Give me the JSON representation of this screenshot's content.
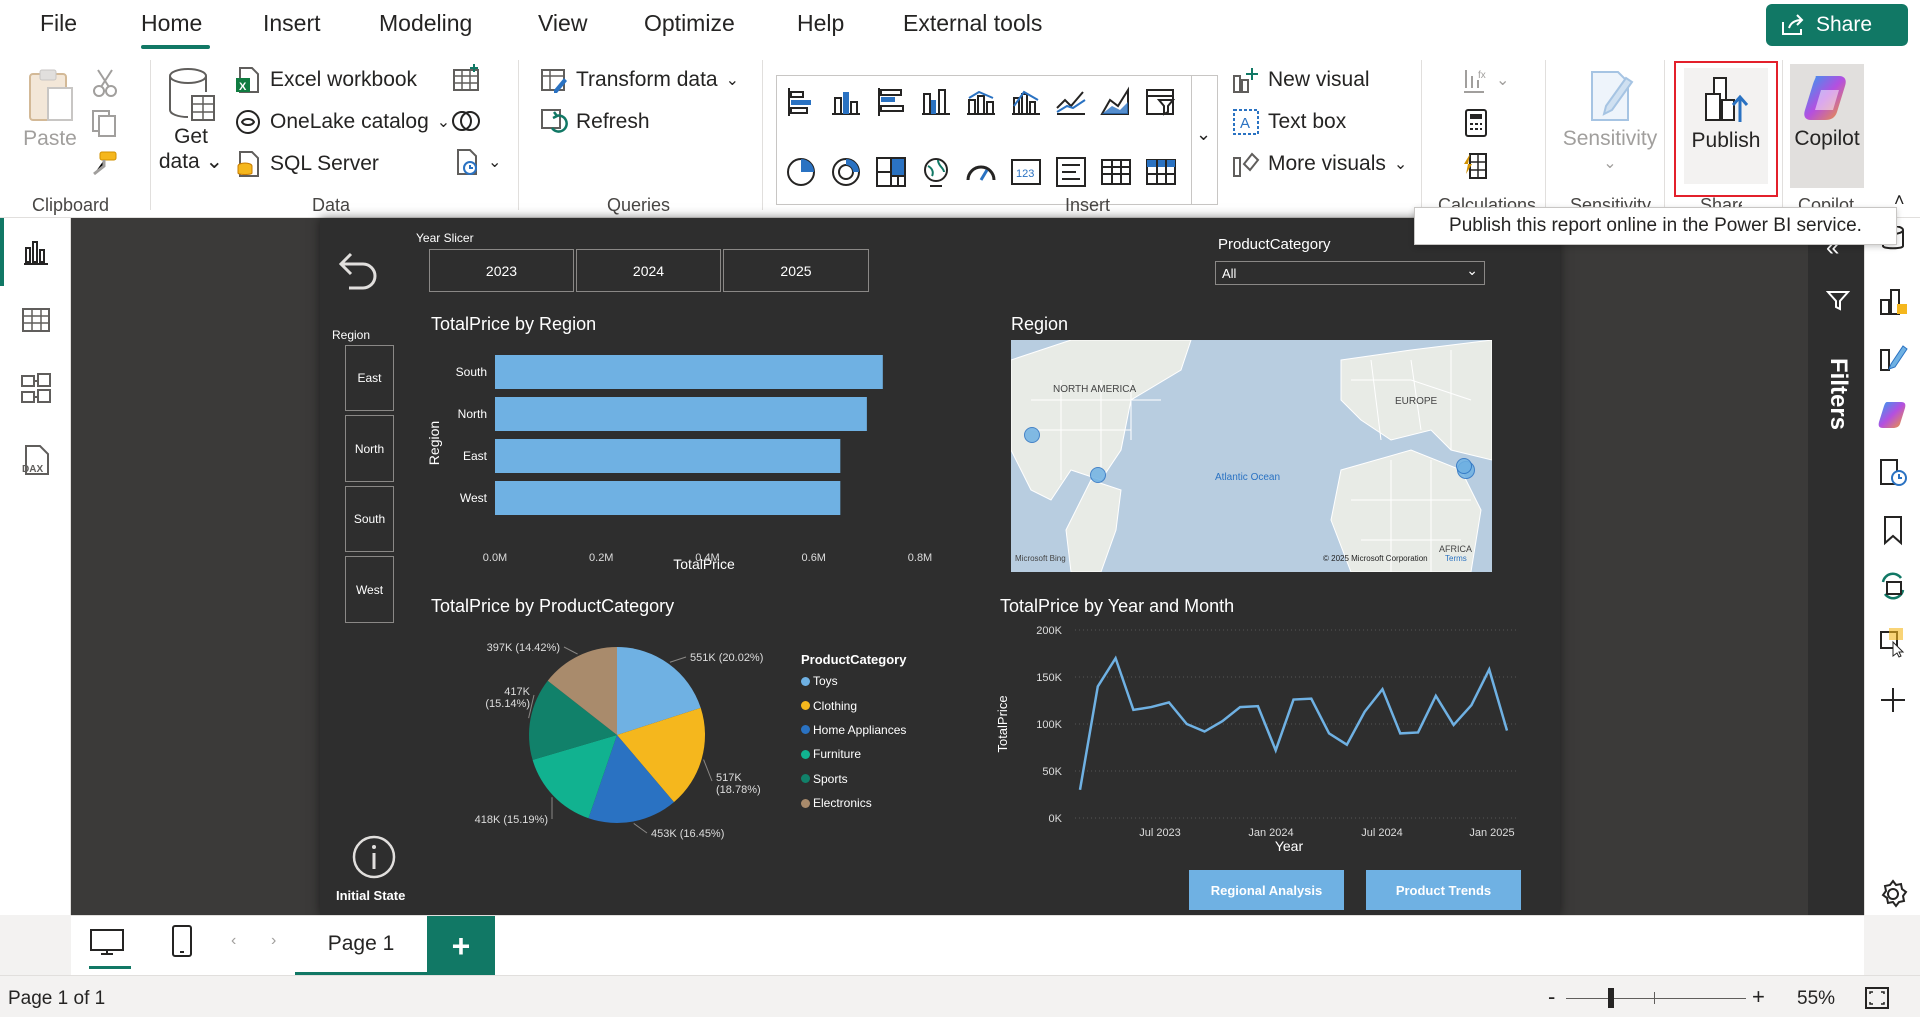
{
  "menubar": {
    "items": [
      "File",
      "Home",
      "Insert",
      "Modeling",
      "View",
      "Optimize",
      "Help",
      "External tools"
    ],
    "active": "Home",
    "share_label": "Share"
  },
  "ribbon": {
    "clipboard": {
      "paste": "Paste",
      "group": "Clipboard"
    },
    "data": {
      "get_data_line1": "Get",
      "get_data_line2": "data",
      "excel": "Excel workbook",
      "onelake": "OneLake catalog",
      "sql": "SQL Server",
      "group": "Data"
    },
    "queries": {
      "transform": "Transform data",
      "refresh": "Refresh",
      "group": "Queries"
    },
    "insert": {
      "new_visual": "New visual",
      "text_box": "Text box",
      "more_visuals": "More visuals",
      "group": "Insert"
    },
    "calculations": {
      "group": "Calculations"
    },
    "sensitivity": {
      "label": "Sensitivity",
      "group": "Sensitivity"
    },
    "share": {
      "publish": "Publish",
      "group": "Share"
    },
    "copilot": {
      "label": "Copilot",
      "group": "Copilot"
    }
  },
  "tooltip": "Publish this report online in the Power BI service.",
  "report": {
    "year_slicer": {
      "title": "Year Slicer",
      "options": [
        "2023",
        "2024",
        "2025"
      ]
    },
    "product_category_slicer": {
      "title": "ProductCategory",
      "selected": "All"
    },
    "region_slicer": {
      "title": "Region",
      "options": [
        "East",
        "North",
        "South",
        "West"
      ]
    },
    "initial_state": "Initial State",
    "buttons": {
      "regional": "Regional Analysis",
      "product": "Product Trends"
    },
    "map": {
      "title": "Region",
      "labels": {
        "north_america": "NORTH AMERICA",
        "europe": "EUROPE",
        "atlantic": "Atlantic Ocean",
        "africa": "AFRICA",
        "bing": "Microsoft Bing",
        "copyright": "© 2025 Microsoft Corporation",
        "terms": "Terms"
      }
    }
  },
  "chart_data": [
    {
      "type": "bar",
      "orientation": "horizontal",
      "title": "TotalPrice by Region",
      "xlabel": "TotalPrice",
      "ylabel": "Region",
      "categories": [
        "South",
        "North",
        "East",
        "West"
      ],
      "values": [
        0.73,
        0.7,
        0.65,
        0.65
      ],
      "xticks": [
        "0.0M",
        "0.2M",
        "0.4M",
        "0.6M",
        "0.8M"
      ],
      "xlim": [
        0,
        0.8
      ],
      "color": "#6fb1e3"
    },
    {
      "type": "pie",
      "title": "TotalPrice by ProductCategory",
      "legend_title": "ProductCategory",
      "slices": [
        {
          "name": "Toys",
          "value": 551,
          "label": "551K (20.02%)",
          "color": "#6fb1e3"
        },
        {
          "name": "Clothing",
          "value": 517,
          "label": "517K (18.78%)",
          "color": "#f5b71d"
        },
        {
          "name": "Home Appliances",
          "value": 453,
          "label": "453K (16.45%)",
          "color": "#2a72c2"
        },
        {
          "name": "Furniture",
          "value": 418,
          "label": "418K (15.19%)",
          "color": "#11b290"
        },
        {
          "name": "Sports",
          "value": 417,
          "label": "417K (15.14%)",
          "color": "#11816a"
        },
        {
          "name": "Electronics",
          "value": 397,
          "label": "397K (14.42%)",
          "color": "#a98b6c"
        }
      ]
    },
    {
      "type": "line",
      "title": "TotalPrice by Year and Month",
      "xlabel": "Year",
      "ylabel": "TotalPrice",
      "yticks": [
        "0K",
        "50K",
        "100K",
        "150K",
        "200K"
      ],
      "ylim": [
        0,
        200000
      ],
      "xticks": [
        "Jul 2023",
        "Jan 2024",
        "Jul 2024",
        "Jan 2025"
      ],
      "x": [
        "2023-03",
        "2023-04",
        "2023-05",
        "2023-06",
        "2023-07",
        "2023-08",
        "2023-09",
        "2023-10",
        "2023-11",
        "2023-12",
        "2024-01",
        "2024-02",
        "2024-03",
        "2024-04",
        "2024-05",
        "2024-06",
        "2024-07",
        "2024-08",
        "2024-09",
        "2024-10",
        "2024-11",
        "2024-12",
        "2025-01",
        "2025-02"
      ],
      "values": [
        30000,
        140000,
        170000,
        115000,
        118000,
        123000,
        100000,
        92000,
        103000,
        118000,
        119000,
        72000,
        126000,
        127000,
        90000,
        78000,
        113000,
        137000,
        90000,
        91000,
        130000,
        99000,
        120000,
        158000,
        93000
      ],
      "color": "#6fb1e3"
    }
  ],
  "filters": {
    "label": "Filters"
  },
  "pagetabs": {
    "page1": "Page 1",
    "add": "+"
  },
  "status": {
    "page_info": "Page 1 of 1",
    "zoom": "55%",
    "minus": "-",
    "plus": "+"
  }
}
